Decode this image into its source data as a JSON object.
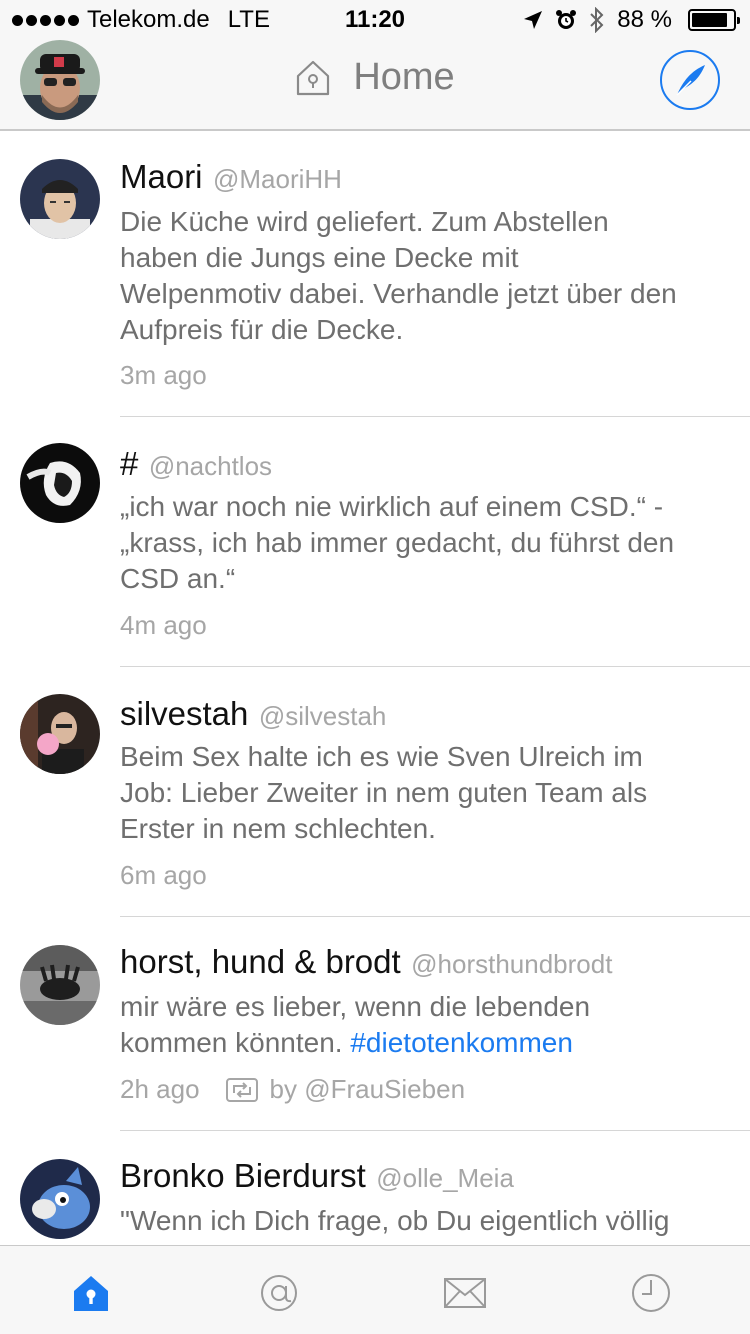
{
  "status_bar": {
    "carrier": "Telekom.de",
    "network": "LTE",
    "time": "11:20",
    "battery": "88 %",
    "battery_level": 0.88,
    "icons": [
      "location-arrow-icon",
      "alarm-icon",
      "bluetooth-icon",
      "battery-icon"
    ]
  },
  "nav": {
    "title": "Home",
    "icons": [
      "home-icon",
      "compose-feather-icon"
    ],
    "accent_color": "#1b7bf0"
  },
  "tweets": [
    {
      "name": "Maori",
      "handle": "@MaoriHH",
      "text_lines": [
        "Die Küche wird geliefert. Zum Abstellen",
        "haben die Jungs eine Decke mit",
        "Welpenmotiv dabei. Verhandle jetzt über den",
        "Aufpreis für die Decke."
      ],
      "time": "3m ago"
    },
    {
      "name": "#",
      "handle": "@nachtlos",
      "text_lines": [
        "„ich war noch nie wirklich auf einem CSD.“ -",
        "„krass, ich hab immer gedacht, du führst den",
        "CSD an.“"
      ],
      "time": "4m ago"
    },
    {
      "name": "silvestah",
      "handle": "@silvestah",
      "text_lines": [
        "Beim Sex halte ich es wie Sven Ulreich im",
        "Job: Lieber Zweiter in nem guten Team als",
        "Erster in nem schlechten."
      ],
      "time": "6m ago"
    },
    {
      "name": "horst, hund & brodt",
      "handle": "@horsthundbrodt",
      "text_line_1": "mir wäre es lieber, wenn die lebenden",
      "text_line_2": "kommen könnten.",
      "hashtag": "#dietotenkommen",
      "time": "2h ago",
      "retweeted_by": "by @FrauSieben"
    },
    {
      "name": "Bronko Bierdurst",
      "handle": "@olle_Meia",
      "text_lines": [
        "\"Wenn ich Dich frage, ob Du eigentlich völlig"
      ]
    }
  ],
  "tab_bar": {
    "tabs": [
      "home-tab",
      "mentions-tab",
      "messages-tab",
      "activity-tab"
    ],
    "active": "home-tab"
  }
}
